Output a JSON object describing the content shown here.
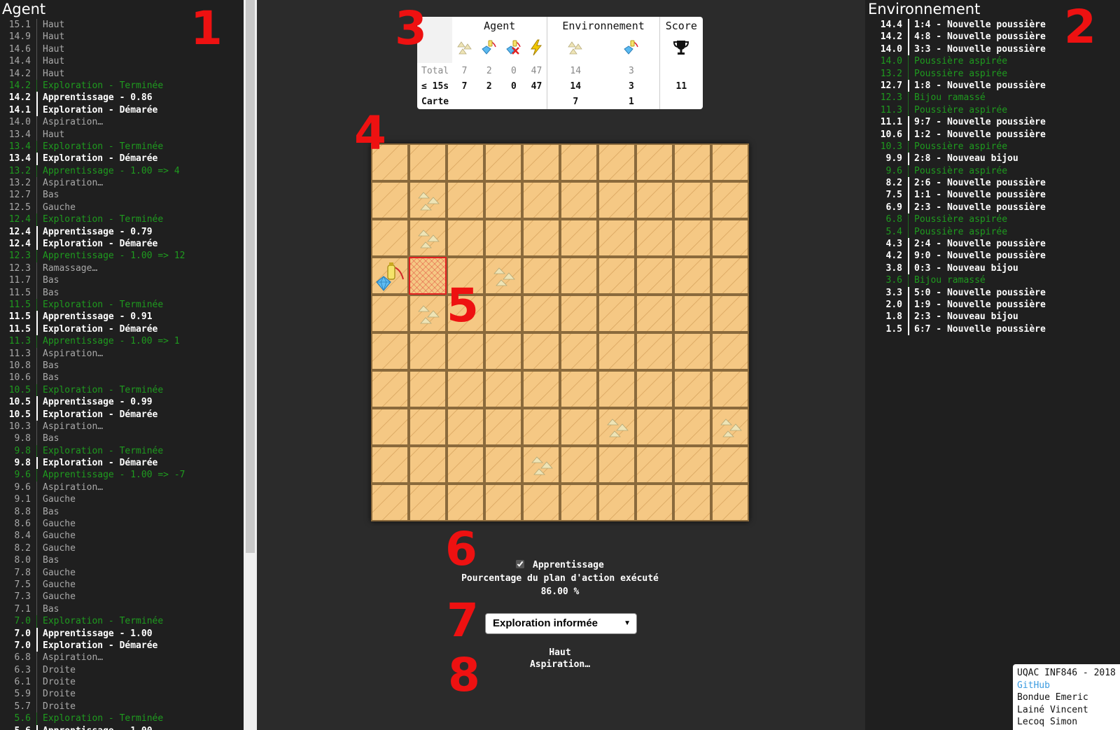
{
  "agent_panel": {
    "title": "Agent",
    "log": [
      {
        "t": "15.1",
        "m": "Haut",
        "s": "normal"
      },
      {
        "t": "14.9",
        "m": "Haut",
        "s": "normal"
      },
      {
        "t": "14.6",
        "m": "Haut",
        "s": "normal"
      },
      {
        "t": "14.4",
        "m": "Haut",
        "s": "normal"
      },
      {
        "t": "14.2",
        "m": "Haut",
        "s": "normal"
      },
      {
        "t": "14.2",
        "m": "Exploration - Terminée",
        "s": "green"
      },
      {
        "t": "14.2",
        "m": "Apprentissage - 0.86",
        "s": "bold"
      },
      {
        "t": "14.1",
        "m": "Exploration - Démarée",
        "s": "bold"
      },
      {
        "t": "14.0",
        "m": "Aspiration…",
        "s": "normal"
      },
      {
        "t": "13.4",
        "m": "Haut",
        "s": "normal"
      },
      {
        "t": "13.4",
        "m": "Exploration - Terminée",
        "s": "green"
      },
      {
        "t": "13.4",
        "m": "Exploration - Démarée",
        "s": "bold"
      },
      {
        "t": "13.2",
        "m": "Apprentissage - 1.00 => 4",
        "s": "green"
      },
      {
        "t": "13.2",
        "m": "Aspiration…",
        "s": "normal"
      },
      {
        "t": "12.7",
        "m": "Bas",
        "s": "normal"
      },
      {
        "t": "12.5",
        "m": "Gauche",
        "s": "normal"
      },
      {
        "t": "12.4",
        "m": "Exploration - Terminée",
        "s": "green"
      },
      {
        "t": "12.4",
        "m": "Apprentissage - 0.79",
        "s": "bold"
      },
      {
        "t": "12.4",
        "m": "Exploration - Démarée",
        "s": "bold"
      },
      {
        "t": "12.3",
        "m": "Apprentissage - 1.00 => 12",
        "s": "green"
      },
      {
        "t": "12.3",
        "m": "Ramassage…",
        "s": "normal"
      },
      {
        "t": "11.7",
        "m": "Bas",
        "s": "normal"
      },
      {
        "t": "11.5",
        "m": "Bas",
        "s": "normal"
      },
      {
        "t": "11.5",
        "m": "Exploration - Terminée",
        "s": "green"
      },
      {
        "t": "11.5",
        "m": "Apprentissage - 0.91",
        "s": "bold"
      },
      {
        "t": "11.5",
        "m": "Exploration - Démarée",
        "s": "bold"
      },
      {
        "t": "11.3",
        "m": "Apprentissage - 1.00 => 1",
        "s": "green"
      },
      {
        "t": "11.3",
        "m": "Aspiration…",
        "s": "normal"
      },
      {
        "t": "10.8",
        "m": "Bas",
        "s": "normal"
      },
      {
        "t": "10.6",
        "m": "Bas",
        "s": "normal"
      },
      {
        "t": "10.5",
        "m": "Exploration - Terminée",
        "s": "green"
      },
      {
        "t": "10.5",
        "m": "Apprentissage - 0.99",
        "s": "bold"
      },
      {
        "t": "10.5",
        "m": "Exploration - Démarée",
        "s": "bold"
      },
      {
        "t": "10.3",
        "m": "Aspiration…",
        "s": "normal"
      },
      {
        "t": "9.8",
        "m": "Bas",
        "s": "normal"
      },
      {
        "t": "9.8",
        "m": "Exploration - Terminée",
        "s": "green"
      },
      {
        "t": "9.8",
        "m": "Exploration - Démarée",
        "s": "bold"
      },
      {
        "t": "9.6",
        "m": "Apprentissage - 1.00 => -7",
        "s": "green"
      },
      {
        "t": "9.6",
        "m": "Aspiration…",
        "s": "normal"
      },
      {
        "t": "9.1",
        "m": "Gauche",
        "s": "normal"
      },
      {
        "t": "8.8",
        "m": "Bas",
        "s": "normal"
      },
      {
        "t": "8.6",
        "m": "Gauche",
        "s": "normal"
      },
      {
        "t": "8.4",
        "m": "Gauche",
        "s": "normal"
      },
      {
        "t": "8.2",
        "m": "Gauche",
        "s": "normal"
      },
      {
        "t": "8.0",
        "m": "Bas",
        "s": "normal"
      },
      {
        "t": "7.8",
        "m": "Gauche",
        "s": "normal"
      },
      {
        "t": "7.5",
        "m": "Gauche",
        "s": "normal"
      },
      {
        "t": "7.3",
        "m": "Gauche",
        "s": "normal"
      },
      {
        "t": "7.1",
        "m": "Bas",
        "s": "normal"
      },
      {
        "t": "7.0",
        "m": "Exploration - Terminée",
        "s": "green"
      },
      {
        "t": "7.0",
        "m": "Apprentissage - 1.00",
        "s": "bold"
      },
      {
        "t": "7.0",
        "m": "Exploration - Démarée",
        "s": "bold"
      },
      {
        "t": "6.8",
        "m": "Aspiration…",
        "s": "normal"
      },
      {
        "t": "6.3",
        "m": "Droite",
        "s": "normal"
      },
      {
        "t": "6.1",
        "m": "Droite",
        "s": "normal"
      },
      {
        "t": "5.9",
        "m": "Droite",
        "s": "normal"
      },
      {
        "t": "5.7",
        "m": "Droite",
        "s": "normal"
      },
      {
        "t": "5.6",
        "m": "Exploration - Terminée",
        "s": "green"
      },
      {
        "t": "5.6",
        "m": "Apprentissage - 1.00",
        "s": "bold"
      }
    ]
  },
  "env_panel": {
    "title": "Environnement",
    "log": [
      {
        "t": "14.4",
        "m": "1:4 - Nouvelle poussière",
        "s": "bold"
      },
      {
        "t": "14.2",
        "m": "4:8 - Nouvelle poussière",
        "s": "bold"
      },
      {
        "t": "14.0",
        "m": "3:3 - Nouvelle poussière",
        "s": "bold"
      },
      {
        "t": "14.0",
        "m": "Poussière aspirée",
        "s": "green"
      },
      {
        "t": "13.2",
        "m": "Poussière aspirée",
        "s": "green"
      },
      {
        "t": "12.7",
        "m": "1:8 - Nouvelle poussière",
        "s": "bold"
      },
      {
        "t": "12.3",
        "m": "Bijou ramassé",
        "s": "green"
      },
      {
        "t": "11.3",
        "m": "Poussière aspirée",
        "s": "green"
      },
      {
        "t": "11.1",
        "m": "9:7 - Nouvelle poussière",
        "s": "bold"
      },
      {
        "t": "10.6",
        "m": "1:2 - Nouvelle poussière",
        "s": "bold"
      },
      {
        "t": "10.3",
        "m": "Poussière aspirée",
        "s": "green"
      },
      {
        "t": "9.9",
        "m": "2:8 - Nouveau bijou",
        "s": "bold"
      },
      {
        "t": "9.6",
        "m": "Poussière aspirée",
        "s": "green"
      },
      {
        "t": "8.2",
        "m": "2:6 - Nouvelle poussière",
        "s": "bold"
      },
      {
        "t": "7.5",
        "m": "1:1 - Nouvelle poussière",
        "s": "bold"
      },
      {
        "t": "6.9",
        "m": "2:3 - Nouvelle poussière",
        "s": "bold"
      },
      {
        "t": "6.8",
        "m": "Poussière aspirée",
        "s": "green"
      },
      {
        "t": "5.4",
        "m": "Poussière aspirée",
        "s": "green"
      },
      {
        "t": "4.3",
        "m": "2:4 - Nouvelle poussière",
        "s": "bold"
      },
      {
        "t": "4.2",
        "m": "9:0 - Nouvelle poussière",
        "s": "bold"
      },
      {
        "t": "3.8",
        "m": "0:3 - Nouveau bijou",
        "s": "bold"
      },
      {
        "t": "3.6",
        "m": "Bijou ramassé",
        "s": "green"
      },
      {
        "t": "3.3",
        "m": "5:0 - Nouvelle poussière",
        "s": "bold"
      },
      {
        "t": "2.0",
        "m": "1:9 - Nouvelle poussière",
        "s": "bold"
      },
      {
        "t": "1.8",
        "m": "2:3 - Nouveau bijou",
        "s": "bold"
      },
      {
        "t": "1.5",
        "m": "6:7 - Nouvelle poussière",
        "s": "bold"
      }
    ]
  },
  "callouts": [
    "1",
    "2",
    "3",
    "4",
    "5",
    "6",
    "7",
    "8"
  ],
  "stats": {
    "headers": {
      "agent": "Agent",
      "environment": "Environnement",
      "score": "Score"
    },
    "row_labels": {
      "total": "Total",
      "recent": "≤ 15s",
      "map": "Carte"
    },
    "total": {
      "agent_dust": "7",
      "agent_jewel": "2",
      "agent_jewel_lost": "0",
      "agent_energy": "47",
      "env_dust": "14",
      "env_jewel": "3"
    },
    "recent": {
      "agent_dust": "7",
      "agent_jewel": "2",
      "agent_jewel_lost": "0",
      "agent_energy": "47",
      "env_dust": "14",
      "env_jewel": "3",
      "score": "11"
    },
    "map": {
      "env_dust": "7",
      "env_jewel": "1"
    },
    "icons": [
      "dust-icon",
      "jewel-icon",
      "jewel-lost-icon",
      "energy-icon",
      "dust-icon",
      "jewel-icon",
      "trophy-icon"
    ]
  },
  "grid": {
    "size": 10,
    "dust_cells": [
      [
        1,
        1
      ],
      [
        2,
        1
      ],
      [
        3,
        3
      ],
      [
        4,
        1
      ],
      [
        7,
        6
      ],
      [
        7,
        9
      ],
      [
        8,
        4
      ]
    ],
    "agent_cell": [
      3,
      0
    ],
    "target_cell": [
      3,
      1
    ]
  },
  "controls": {
    "learning_label": "Apprentissage",
    "learning_checked": true,
    "plan_label": "Pourcentage du plan d'action exécuté",
    "plan_value": "86.00 %",
    "strategy_selected": "Exploration informée"
  },
  "current_actions": [
    "Haut",
    "Aspiration…"
  ],
  "credits": {
    "line1": "UQAC INF846 - 2018",
    "link": "GitHub",
    "authors": [
      "Bondue Emeric",
      "Lainé Vincent",
      "Lecoq Simon"
    ]
  },
  "colors": {
    "green_log": "#1f9b1f",
    "callout_red": "#ee1111",
    "link_blue": "#3b9be0",
    "tile": "#f5c884"
  }
}
